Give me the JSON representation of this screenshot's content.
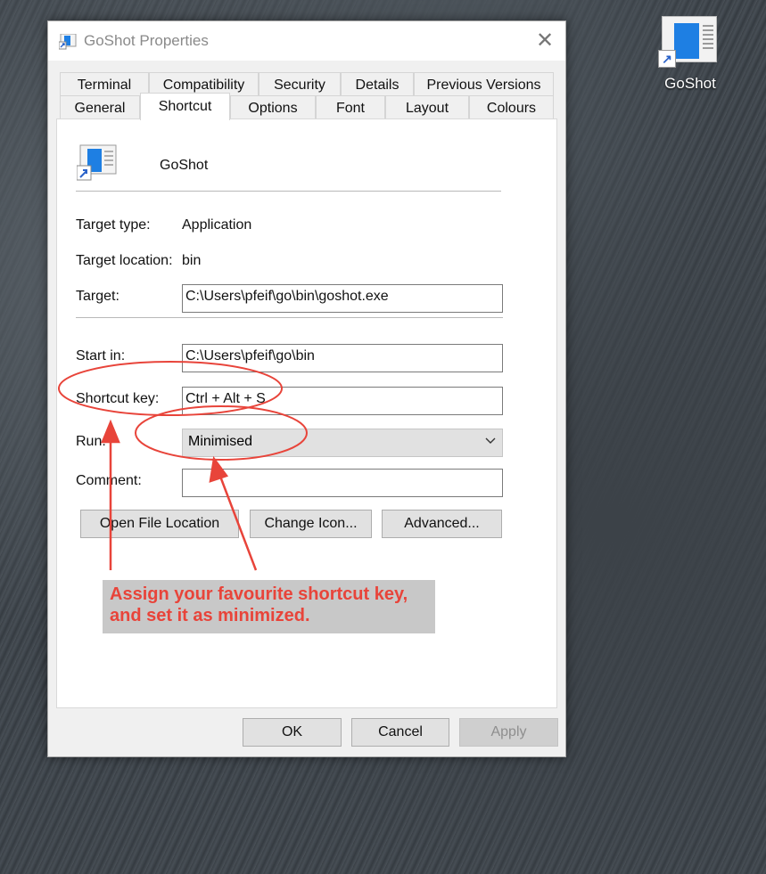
{
  "desktop": {
    "icon_label": "GoShot"
  },
  "window": {
    "title": "GoShot Properties",
    "close_glyph": "✕"
  },
  "tabs_row1": [
    "Terminal",
    "Compatibility",
    "Security",
    "Details",
    "Previous Versions"
  ],
  "tabs_row2": [
    "General",
    "Shortcut",
    "Options",
    "Font",
    "Layout",
    "Colours"
  ],
  "active_tab": "Shortcut",
  "shortcut": {
    "name": "GoShot",
    "target_type_label": "Target type:",
    "target_type_value": "Application",
    "target_location_label": "Target location:",
    "target_location_value": "bin",
    "target_label": "Target:",
    "target_value": "C:\\Users\\pfeif\\go\\bin\\goshot.exe",
    "start_in_label": "Start in:",
    "start_in_value": "C:\\Users\\pfeif\\go\\bin",
    "shortcut_key_label": "Shortcut key:",
    "shortcut_key_value": "Ctrl + Alt + S",
    "run_label": "Run:",
    "run_value": "Minimised",
    "comment_label": "Comment:",
    "comment_value": ""
  },
  "buttons": {
    "open_file_location": "Open File Location",
    "change_icon": "Change Icon...",
    "advanced": "Advanced...",
    "ok": "OK",
    "cancel": "Cancel",
    "apply": "Apply"
  },
  "annotation": {
    "line1": "Assign your favourite shortcut key,",
    "line2": "and set it as minimized.",
    "color": "#e8443a"
  },
  "icons": [
    "shortcut-app-icon",
    "shortcut-arrow-icon",
    "close-icon",
    "chevron-down-icon"
  ]
}
